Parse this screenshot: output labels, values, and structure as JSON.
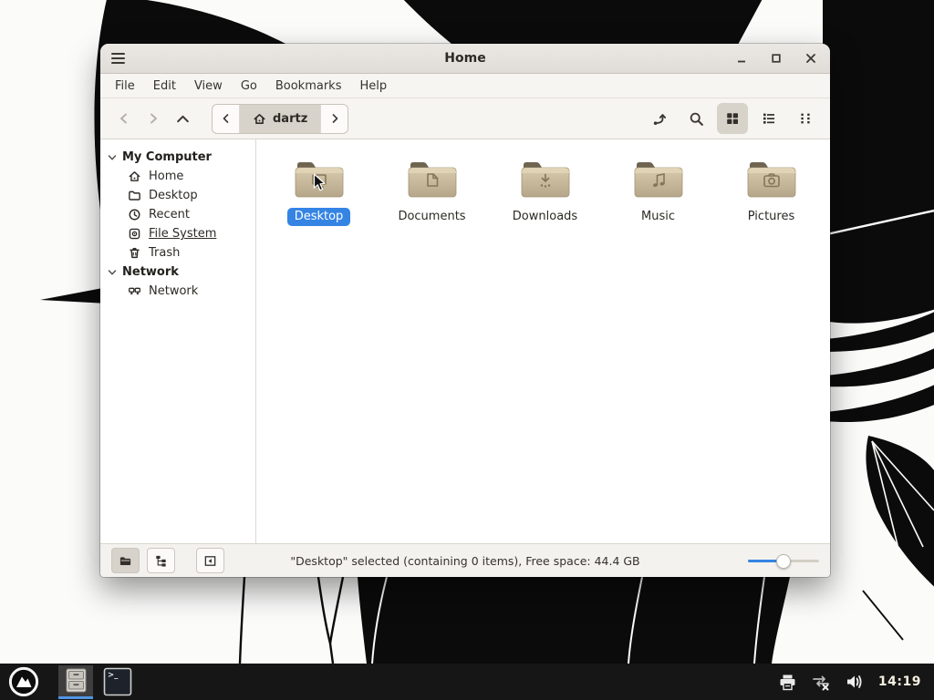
{
  "colors": {
    "accent_blue": "#3584e4",
    "taskbar_bg": "#161616",
    "window_bg": "#f5f3f0",
    "folder_body": "#cdbfa2",
    "folder_tab": "#6e6450",
    "taskbar_active_underline": "#5294e2"
  },
  "window": {
    "title": "Home",
    "menubar": [
      "File",
      "Edit",
      "View",
      "Go",
      "Bookmarks",
      "Help"
    ],
    "toolbar": {
      "path_current": "dartz",
      "active_view": "icon-view"
    },
    "sidebar": {
      "sections": [
        {
          "label": "My Computer",
          "items": [
            {
              "icon": "home-icon",
              "label": "Home"
            },
            {
              "icon": "folder-icon",
              "label": "Desktop"
            },
            {
              "icon": "clock-icon",
              "label": "Recent"
            },
            {
              "icon": "drive-icon",
              "label": "File System",
              "underlined": true
            },
            {
              "icon": "trash-icon",
              "label": "Trash"
            }
          ]
        },
        {
          "label": "Network",
          "items": [
            {
              "icon": "network-icon",
              "label": "Network"
            }
          ]
        }
      ]
    },
    "files": [
      {
        "label": "Desktop",
        "icon": "folder-desktop-icon",
        "selected": true
      },
      {
        "label": "Documents",
        "icon": "folder-documents-icon",
        "selected": false
      },
      {
        "label": "Downloads",
        "icon": "folder-downloads-icon",
        "selected": false
      },
      {
        "label": "Music",
        "icon": "folder-music-icon",
        "selected": false
      },
      {
        "label": "Pictures",
        "icon": "folder-pictures-icon",
        "selected": false
      }
    ],
    "statusbar": {
      "text": "\"Desktop\" selected (containing 0 items), Free space: 44.4 GB",
      "zoom_percent": 50
    }
  },
  "taskbar": {
    "clock": "14:19",
    "terminal_glyph": ">_"
  }
}
